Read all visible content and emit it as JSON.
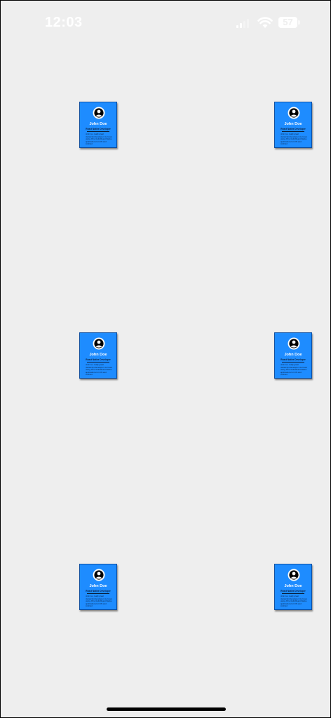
{
  "status_bar": {
    "time": "12:03",
    "battery_level": "57"
  },
  "profile": {
    "name": "John Doe",
    "role": "React Native Developer",
    "bio": "John is a really great Javascript developer. He loves using JS to build React Native applications for iOS and Android"
  },
  "colors": {
    "background": "#eeeeee",
    "card": "#1e8cff",
    "card_border": "#0c4da0"
  }
}
